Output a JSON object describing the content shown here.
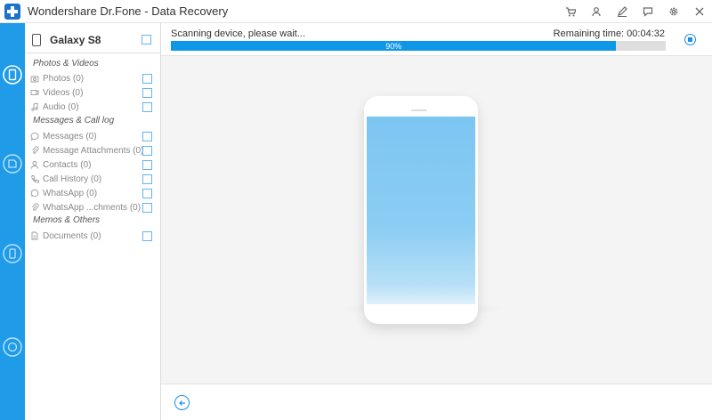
{
  "app": {
    "title": "Wondershare Dr.Fone - Data Recovery"
  },
  "title_icons": [
    "cart-icon",
    "user-icon",
    "pen-icon",
    "chat-icon",
    "gear-icon",
    "close-icon"
  ],
  "rail": {
    "items": [
      "phone-recover-icon",
      "sd-recover-icon",
      "ios-recover-icon",
      "whatsapp-recover-icon"
    ]
  },
  "device": {
    "name": "Galaxy S8"
  },
  "categories": {
    "photos_videos": "Photos & Videos",
    "messages_calllog": "Messages & Call log",
    "memos_others": "Memos & Others"
  },
  "items": {
    "photos": "Photos (0)",
    "videos": "Videos (0)",
    "audio": "Audio (0)",
    "messages": "Messages (0)",
    "message_attachments": "Message Attachments (0)",
    "contacts": "Contacts (0)",
    "call_history": "Call History (0)",
    "whatsapp": "WhatsApp (0)",
    "whatsapp_attachments": "WhatsApp ...chments (0)",
    "documents": "Documents (0)"
  },
  "scan": {
    "status": "Scanning device, please wait...",
    "remaining": "Remaining time: 00:04:32",
    "progress_label": "90%",
    "progress_value": 0.9
  },
  "colors": {
    "accent": "#1f9be8",
    "progress": "#0e97e6"
  }
}
